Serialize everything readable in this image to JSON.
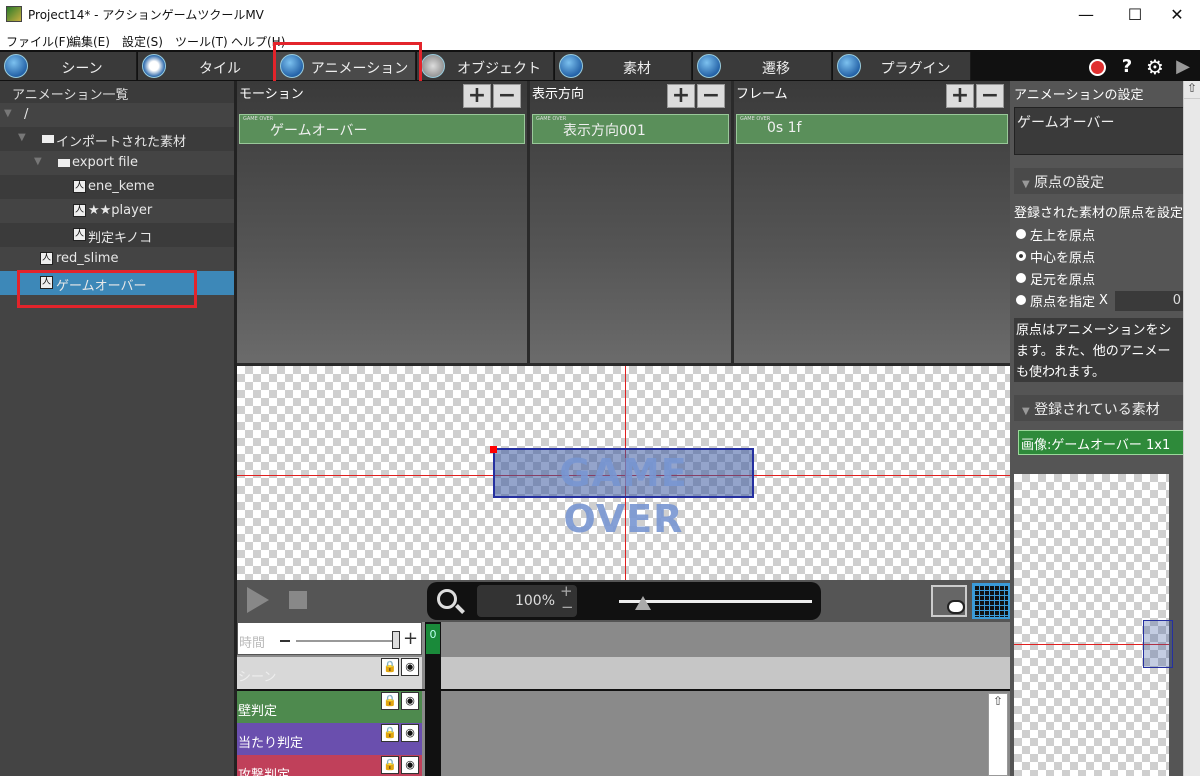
{
  "window": {
    "title": "Project14* - アクションゲームツクールMV",
    "minimize": "—",
    "maximize": "☐",
    "close": "✕"
  },
  "menu": [
    "ファイル(F)",
    "編集(E)",
    "設定(S)",
    "ツール(T)",
    "ヘルプ(H)"
  ],
  "tabs": [
    {
      "label": "シーン",
      "icon": "scene-icon"
    },
    {
      "label": "タイル",
      "icon": "tile-icon"
    },
    {
      "label": "アニメーション",
      "icon": "animation-icon",
      "active": true
    },
    {
      "label": "オブジェクト",
      "icon": "object-icon"
    },
    {
      "label": "素材",
      "icon": "asset-icon"
    },
    {
      "label": "遷移",
      "icon": "transition-icon"
    },
    {
      "label": "プラグイン",
      "icon": "plugin-icon"
    }
  ],
  "toolbar_right": {
    "help": "?",
    "settings_icon": "gear-icon",
    "play_icon": "play-icon"
  },
  "left_panel": {
    "header": "アニメーション一覧",
    "root": "/",
    "items": [
      {
        "label": "インポートされた素材",
        "type": "folder"
      },
      {
        "label": "export file",
        "type": "folder"
      },
      {
        "label": "ene_keme",
        "type": "animation"
      },
      {
        "label": "★★player",
        "type": "animation"
      },
      {
        "label": "判定キノコ",
        "type": "animation"
      },
      {
        "label": "red_slime",
        "type": "animation"
      },
      {
        "label": "ゲームオーバー",
        "type": "animation",
        "selected": true
      }
    ]
  },
  "columns": {
    "motion": {
      "header": "モーション",
      "item": "ゲームオーバー",
      "thumb": "GAME OVER"
    },
    "direction": {
      "header": "表示方向",
      "item": "表示方向001",
      "thumb": "GAME OVER"
    },
    "frame": {
      "header": "フレーム",
      "item": "0s 1f",
      "thumb": "GAME OVER"
    },
    "add": "+",
    "remove": "−"
  },
  "canvas": {
    "sprite_text": "GAME OVER"
  },
  "playback": {
    "zoom": "100%",
    "zoom_plus": "+",
    "zoom_minus": "−"
  },
  "timeline": {
    "time_label": "時間",
    "frame_marker": "0",
    "tracks": [
      {
        "name": "シーン",
        "color": "#d8d8d8"
      },
      {
        "name": "壁判定",
        "color": "#4e8a4e"
      },
      {
        "name": "当たり判定",
        "color": "#6a4fae"
      },
      {
        "name": "攻撃判定",
        "color": "#c0405a"
      }
    ]
  },
  "right_panel": {
    "header": "アニメーションの設定",
    "name": "ゲームオーバー",
    "origin_section": "原点の設定",
    "origin_desc": "登録された素材の原点を設定",
    "origin_options": [
      {
        "label": "左上を原点",
        "selected": false
      },
      {
        "label": "中心を原点",
        "selected": true
      },
      {
        "label": "足元を原点",
        "selected": false
      },
      {
        "label": "原点を指定",
        "selected": false
      }
    ],
    "x_label": "X",
    "x_value": "0",
    "description_lines": [
      "原点はアニメーションをシ",
      "ます。また、他のアニメー",
      "も使われます。"
    ],
    "assets_section": "登録されている素材",
    "asset_item": "画像:ゲームオーバー 1x1"
  }
}
